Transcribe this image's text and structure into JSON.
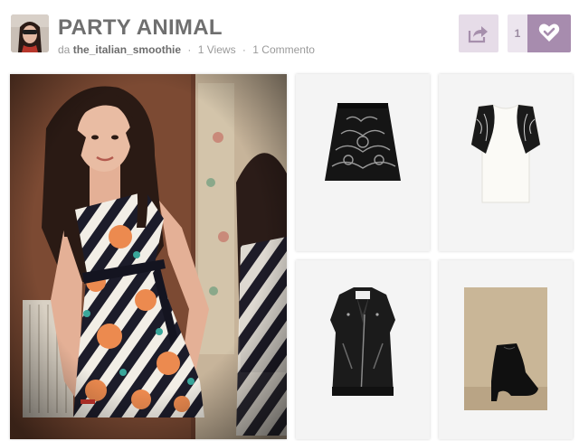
{
  "header": {
    "title": "PARTY ANIMAL",
    "by_prefix": "da",
    "username": "the_italian_smoothie",
    "separator": "·",
    "views": "1 Views",
    "comments": "1 Commento"
  },
  "actions": {
    "share_icon": "share-arrow-icon",
    "like_count": "1",
    "like_icon": "heart-check-icon"
  },
  "colors": {
    "accent": "#a78cae",
    "accent_light": "#e6dce8",
    "title": "#6f6f6f",
    "meta": "#9a9a9a"
  },
  "items": [
    {
      "name": "photo",
      "kind": "outfit-photo"
    },
    {
      "name": "skirt",
      "kind": "black-baroque-print-skirt"
    },
    {
      "name": "top",
      "kind": "white-top-black-lace-sleeves"
    },
    {
      "name": "vest",
      "kind": "black-leather-biker-vest"
    },
    {
      "name": "boot",
      "kind": "black-ankle-boot"
    }
  ]
}
